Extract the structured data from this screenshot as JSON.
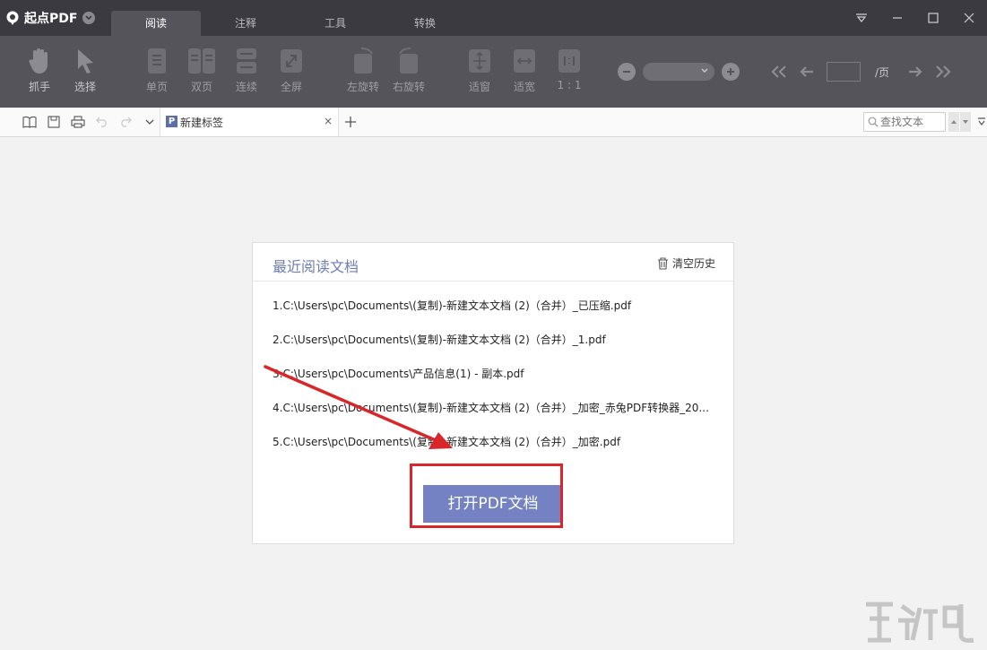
{
  "app": {
    "name": "起点PDF"
  },
  "menu_tabs": [
    {
      "label": "阅读",
      "active": true
    },
    {
      "label": "注释",
      "active": false
    },
    {
      "label": "工具",
      "active": false
    },
    {
      "label": "转换",
      "active": false
    }
  ],
  "toolbar": {
    "grab": "抓手",
    "select": "选择",
    "single": "单页",
    "double": "双页",
    "continuous": "连续",
    "fullscreen": "全屏",
    "rotate_left": "左旋转",
    "rotate_right": "右旋转",
    "fit_window": "适窗",
    "fit_width": "适宽",
    "actual": "1 : 1",
    "page_suffix": "/页"
  },
  "document_tabs": [
    {
      "title": "新建标签"
    }
  ],
  "search": {
    "placeholder": "查找文本"
  },
  "recent": {
    "title": "最近阅读文档",
    "clear_label": "清空历史",
    "items": [
      "1.C:\\Users\\pc\\Documents\\(复制)-新建文本文档 (2)（合并）_已压缩.pdf",
      "2.C:\\Users\\pc\\Documents\\(复制)-新建文本文档 (2)（合并）_1.pdf",
      "3.C:\\Users\\pc\\Documents\\产品信息(1) - 副本.pdf",
      "4.C:\\Users\\pc\\Documents\\(复制)-新建文本文档 (2)（合并）_加密_赤兔PDF转换器_20...",
      "5.C:\\Users\\pc\\Documents\\(复制)-新建文本文档 (2)（合并）_加密.pdf"
    ],
    "open_button": "打开PDF文档"
  },
  "colors": {
    "titlebar": "#3b3a40",
    "toolbar": "#55545a",
    "accent": "#7482c4",
    "highlight": "#d8262b"
  }
}
